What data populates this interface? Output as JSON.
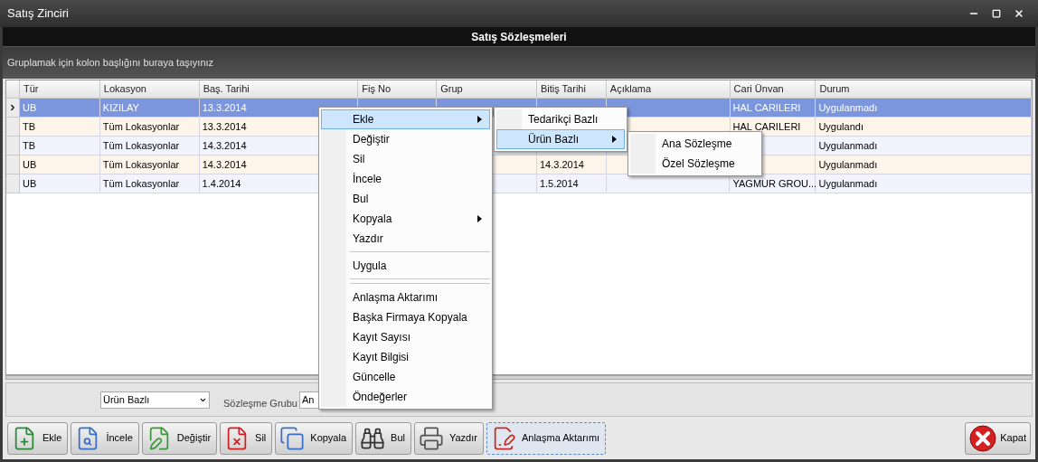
{
  "window": {
    "title": "Satış Zinciri"
  },
  "header": {
    "title": "Satış Sözleşmeleri"
  },
  "group_panel": {
    "hint": "Gruplamak için kolon başlığını buraya taşıyınız"
  },
  "table": {
    "columns": [
      "Tür",
      "Lokasyon",
      "Baş. Tarihi",
      "Fiş No",
      "Grup",
      "Bitiş Tarihi",
      "Açıklama",
      "Cari Ünvan",
      "Durum"
    ],
    "rows": [
      {
        "selected": true,
        "cells": [
          "UB",
          "KIZILAY",
          "13.3.2014",
          null,
          null,
          null,
          null,
          "HAL CARILERI",
          "Uygulanmadı"
        ]
      },
      {
        "selected": false,
        "cells": [
          "TB",
          "Tüm Lokasyonlar",
          "13.3.2014",
          null,
          null,
          null,
          null,
          "HAL CARILERI",
          "Uygulandı"
        ]
      },
      {
        "selected": false,
        "cells": [
          "TB",
          "Tüm Lokasyonlar",
          "14.3.2014",
          null,
          null,
          null,
          null,
          null,
          "Uygulanmadı"
        ]
      },
      {
        "selected": false,
        "cells": [
          "UB",
          "Tüm Lokasyonlar",
          "14.3.2014",
          null,
          null,
          "14.3.2014",
          null,
          null,
          "Uygulanmadı"
        ]
      },
      {
        "selected": false,
        "cells": [
          "UB",
          "Tüm Lokasyonlar",
          "1.4.2014",
          null,
          null,
          "1.5.2014",
          null,
          "YAGMUR GROU...",
          "Uygulanmadı"
        ]
      }
    ]
  },
  "filters": {
    "type_select": {
      "value": "Ürün Bazlı"
    },
    "group_label": "Sözleşme Grubu",
    "group_field": {
      "value": "An"
    }
  },
  "toolbar": [
    {
      "label": "Ekle",
      "selected": false
    },
    {
      "label": "İncele",
      "selected": false
    },
    {
      "label": "Değiştir",
      "selected": false
    },
    {
      "label": "Sil",
      "selected": false
    },
    {
      "label": "Kopyala",
      "selected": false
    },
    {
      "label": "Bul",
      "selected": false
    },
    {
      "label": "Yazdır",
      "selected": false
    },
    {
      "label": "Anlaşma Aktarımı",
      "selected": true
    }
  ],
  "close_button": {
    "label": "Kapat"
  },
  "context_menu": {
    "items": [
      {
        "kind": "item",
        "label": "Ekle",
        "submenu": true,
        "selected": true
      },
      {
        "kind": "item",
        "label": "Değiştir",
        "submenu": false,
        "selected": false
      },
      {
        "kind": "item",
        "label": "Sil",
        "submenu": false,
        "selected": false
      },
      {
        "kind": "item",
        "label": "İncele",
        "submenu": false,
        "selected": false
      },
      {
        "kind": "item",
        "label": "Bul",
        "submenu": false,
        "selected": false
      },
      {
        "kind": "item",
        "label": "Kopyala",
        "submenu": true,
        "selected": false
      },
      {
        "kind": "item",
        "label": "Yazdır",
        "submenu": false,
        "selected": false
      },
      {
        "kind": "separator"
      },
      {
        "kind": "item",
        "label": "Uygula",
        "submenu": false,
        "selected": false
      },
      {
        "kind": "separator"
      },
      {
        "kind": "separator"
      },
      {
        "kind": "item",
        "label": "Anlaşma Aktarımı",
        "submenu": false,
        "selected": false
      },
      {
        "kind": "item",
        "label": "Başka Firmaya Kopyala",
        "submenu": false,
        "selected": false
      },
      {
        "kind": "item",
        "label": "Kayıt Sayısı",
        "submenu": false,
        "selected": false
      },
      {
        "kind": "item",
        "label": "Kayıt Bilgisi",
        "submenu": false,
        "selected": false
      },
      {
        "kind": "item",
        "label": "Güncelle",
        "submenu": false,
        "selected": false
      },
      {
        "kind": "item",
        "label": "Öndeğerler",
        "submenu": false,
        "selected": false
      }
    ],
    "submenu": {
      "items": [
        {
          "kind": "item",
          "label": "Tedarikçi Bazlı",
          "submenu": false,
          "selected": false
        },
        {
          "kind": "item",
          "label": "Ürün Bazlı",
          "submenu": true,
          "selected": true
        }
      ]
    },
    "submenu_2": {
      "items": [
        {
          "kind": "item",
          "label": "Ana Sözleşme",
          "submenu": false,
          "selected": false
        },
        {
          "kind": "item",
          "label": "Özel Sözleşme",
          "submenu": false,
          "selected": false
        }
      ]
    }
  }
}
